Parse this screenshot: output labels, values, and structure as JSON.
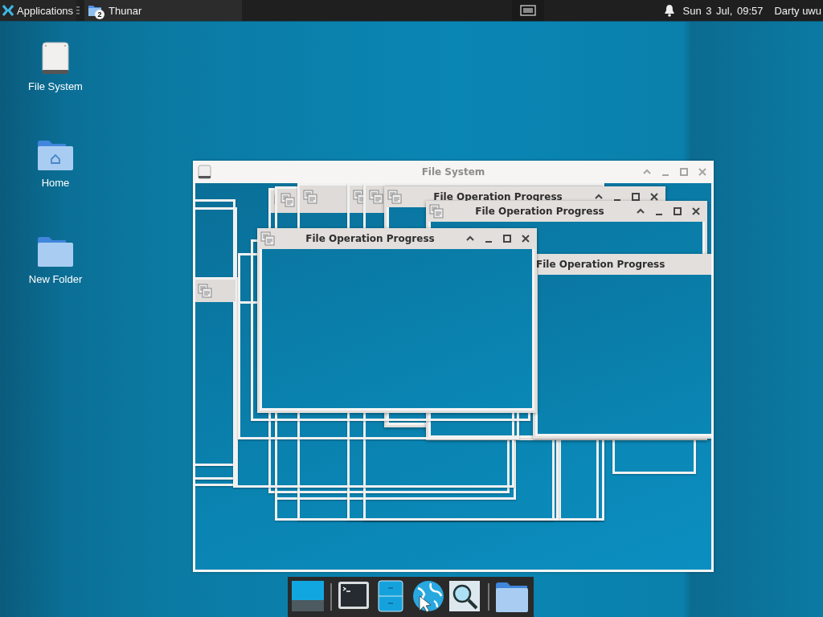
{
  "panel": {
    "menu": {
      "label": "Applications"
    },
    "tasks": [
      {
        "label": "Thunar",
        "badge": "2"
      }
    ],
    "clock": "Sun 3 Jul, 09:57",
    "user": "Darty uwu"
  },
  "desktop_icons": [
    {
      "label": "File System",
      "kind": "drive"
    },
    {
      "label": "Home",
      "kind": "home"
    },
    {
      "label": "New Folder",
      "kind": "folder"
    }
  ],
  "main_window": {
    "title": "File System"
  },
  "progress_windows": [
    {
      "title": "File Operation Progress"
    },
    {
      "title": "File Operation Progress"
    },
    {
      "title": "File Operation Progress"
    },
    {
      "title": "File Operation Progress"
    }
  ],
  "dock": [
    {
      "kind": "desktop"
    },
    {
      "kind": "separator"
    },
    {
      "kind": "terminal"
    },
    {
      "kind": "files"
    },
    {
      "kind": "browser"
    },
    {
      "kind": "search"
    },
    {
      "kind": "separator"
    },
    {
      "kind": "folder"
    }
  ]
}
